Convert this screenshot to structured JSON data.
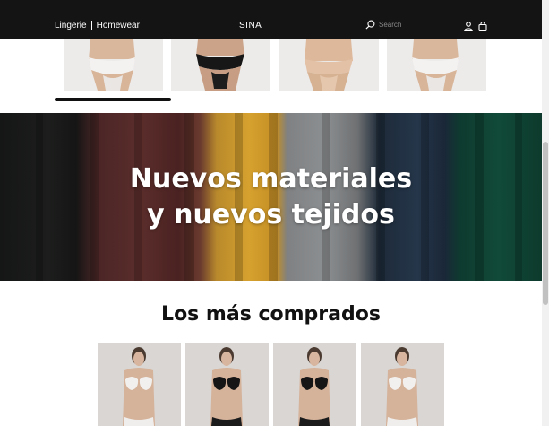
{
  "header": {
    "nav": [
      {
        "label": "Lingerie"
      },
      {
        "label": "Homewear"
      }
    ],
    "brand": "SINA",
    "search": {
      "placeholder": "Search",
      "value": ""
    }
  },
  "top_carousel": {
    "items": [
      {
        "icon": "panty-white-lace-image"
      },
      {
        "icon": "panty-black-lace-image"
      },
      {
        "icon": "panty-nude-image"
      },
      {
        "icon": "panty-white-lace-image"
      }
    ]
  },
  "banner": {
    "line1": "Nuevos materiales",
    "line2": "y nuevos tejidos"
  },
  "best_sellers": {
    "title": "Los más comprados",
    "products": [
      {
        "icon": "white-bra-set-image"
      },
      {
        "icon": "black-bra-set-image"
      },
      {
        "icon": "black-bra-set-image"
      },
      {
        "icon": "white-bra-set-image"
      }
    ]
  },
  "colors": {
    "header_bg": "#141414",
    "accent_text": "#ffffff",
    "card_bg": "#d9d6d4"
  }
}
